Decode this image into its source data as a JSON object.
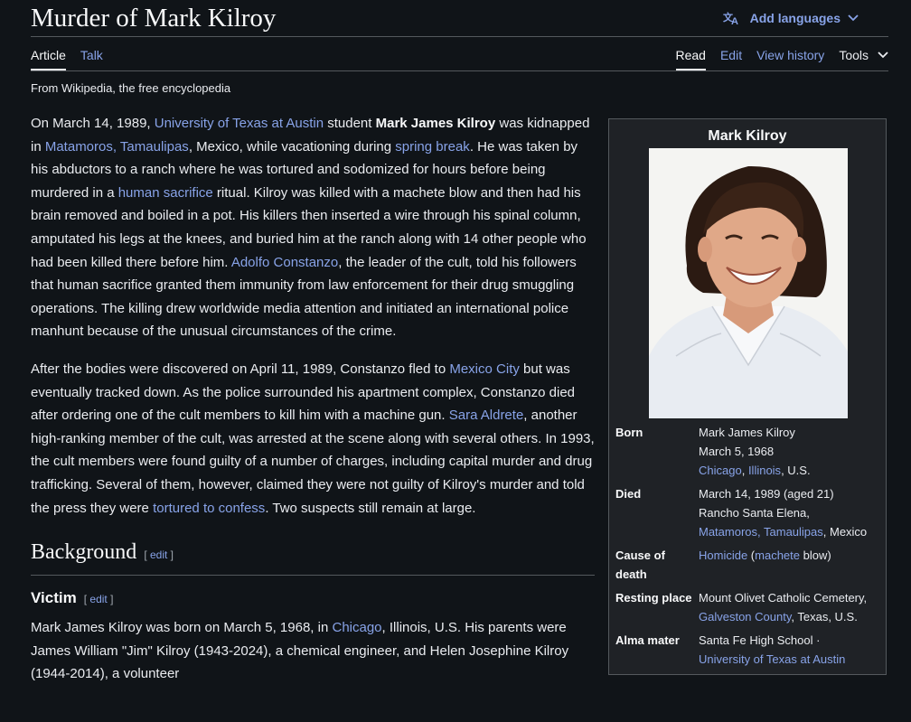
{
  "header": {
    "title": "Murder of Mark Kilroy",
    "add_languages": "Add languages"
  },
  "tabs": {
    "article": "Article",
    "talk": "Talk",
    "read": "Read",
    "edit": "Edit",
    "view_history": "View history",
    "tools": "Tools"
  },
  "tagline": "From Wikipedia, the free encyclopedia",
  "para1": {
    "t1": "On March 14, 1989, ",
    "l1": "University of Texas at Austin",
    "t2": " student ",
    "b1": "Mark James Kilroy",
    "t3": " was kidnapped in ",
    "l2": "Matamoros, Tamaulipas",
    "t4": ", Mexico, while vacationing during ",
    "l3": "spring break",
    "t5": ". He was taken by his abductors to a ranch where he was tortured and sodomized for hours before being murdered in a ",
    "l4": "human sacrifice",
    "t6": " ritual. Kilroy was killed with a machete blow and then had his brain removed and boiled in a pot. His killers then inserted a wire through his spinal column, amputated his legs at the knees, and buried him at the ranch along with 14 other people who had been killed there before him. ",
    "l5": "Adolfo Constanzo",
    "t7": ", the leader of the cult, told his followers that human sacrifice granted them immunity from law enforcement for their drug smuggling operations. The killing drew worldwide media attention and initiated an international police manhunt because of the unusual circumstances of the crime."
  },
  "para2": {
    "t1": "After the bodies were discovered on April 11, 1989, Constanzo fled to ",
    "l1": "Mexico City",
    "t2": " but was eventually tracked down. As the police surrounded his apartment complex, Constanzo died after ordering one of the cult members to kill him with a machine gun. ",
    "l2": "Sara Aldrete",
    "t3": ", another high-ranking member of the cult, was arrested at the scene along with several others. In 1993, the cult members were found guilty of a number of charges, including capital murder and drug trafficking. Several of them, however, claimed they were not guilty of Kilroy's murder and told the press they were ",
    "l3": "tortured to confess",
    "t4": ". Two suspects still remain at large."
  },
  "background": {
    "heading": "Background",
    "edit": "edit",
    "open": "[ ",
    "close": " ]"
  },
  "victim": {
    "heading": "Victim",
    "edit": "edit",
    "t1": "Mark James Kilroy was born on March 5, 1968, in ",
    "l1": "Chicago",
    "t2": ", Illinois, U.S. His parents were James William \"Jim\" Kilroy (1943-2024), a chemical engineer, and Helen Josephine Kilroy (1944-2014), a volunteer"
  },
  "infobox": {
    "title": "Mark Kilroy",
    "born": {
      "label": "Born",
      "name": "Mark James Kilroy",
      "date": "March 5, 1968",
      "l1": "Chicago",
      "sep": ", ",
      "l2": "Illinois",
      "tail": ", U.S."
    },
    "died": {
      "label": "Died",
      "date": "March 14, 1989 (aged 21)",
      "place": "Rancho Santa Elena,",
      "l1": "Matamoros, Tamaulipas",
      "tail": ", Mexico"
    },
    "cause": {
      "label": "Cause of death",
      "l1": "Homicide",
      "t1": " (",
      "l2": "machete",
      "t2": " blow)"
    },
    "resting": {
      "label": "Resting place",
      "t1": "Mount Olivet Catholic Cemetery,",
      "l1": "Galveston County",
      "t2": ", Texas, U.S."
    },
    "alma": {
      "label": "Alma mater",
      "t1": "Santa Fe High School ·",
      "l1": "University of Texas at Austin"
    }
  },
  "colors": {
    "background": "#101418",
    "text": "#eaecf0",
    "link": "#88a3e8",
    "infobox_bg": "#1f2226",
    "border": "#54595d"
  }
}
